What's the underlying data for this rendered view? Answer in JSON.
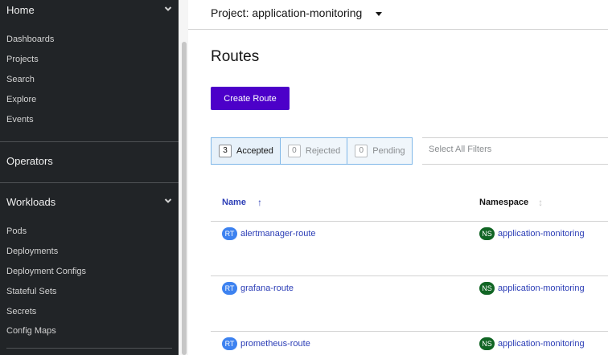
{
  "sidebar": {
    "home": {
      "label": "Home",
      "items": [
        {
          "label": "Dashboards"
        },
        {
          "label": "Projects"
        },
        {
          "label": "Search"
        },
        {
          "label": "Explore"
        },
        {
          "label": "Events"
        }
      ]
    },
    "operators": {
      "label": "Operators"
    },
    "workloads": {
      "label": "Workloads",
      "items": [
        {
          "label": "Pods"
        },
        {
          "label": "Deployments"
        },
        {
          "label": "Deployment Configs"
        },
        {
          "label": "Stateful Sets"
        },
        {
          "label": "Secrets"
        },
        {
          "label": "Config Maps"
        }
      ]
    }
  },
  "project_selector": {
    "label": "Project: application-monitoring"
  },
  "page": {
    "title": "Routes",
    "create_button": "Create Route"
  },
  "filters": {
    "items": [
      {
        "count": "3",
        "label": "Accepted",
        "state": "active"
      },
      {
        "count": "0",
        "label": "Rejected",
        "state": "inactive"
      },
      {
        "count": "0",
        "label": "Pending",
        "state": "inactive"
      }
    ],
    "select_all": "Select All Filters"
  },
  "table": {
    "columns": [
      {
        "label": "Name",
        "sort": "ascending"
      },
      {
        "label": "Namespace",
        "sort": "none"
      }
    ],
    "rows": [
      {
        "badge": "RT",
        "name": "alertmanager-route",
        "ns_badge": "NS",
        "namespace": "application-monitoring"
      },
      {
        "badge": "RT",
        "name": "grafana-route",
        "ns_badge": "NS",
        "namespace": "application-monitoring"
      },
      {
        "badge": "RT",
        "name": "prometheus-route",
        "ns_badge": "NS",
        "namespace": "application-monitoring"
      }
    ]
  },
  "colors": {
    "sidebar_bg": "#212427",
    "primary_button": "#4c00c9",
    "link": "#2b3db6",
    "route_badge": "#3d82f0",
    "namespace_badge": "#116524",
    "filter_border": "#7fb7e8"
  },
  "icons": {
    "expand": "chevron-down-icon",
    "project_dropdown": "caret-down-icon",
    "sort_asc": "sort-arrow-up-icon",
    "sort_none": "sort-neutral-icon"
  }
}
